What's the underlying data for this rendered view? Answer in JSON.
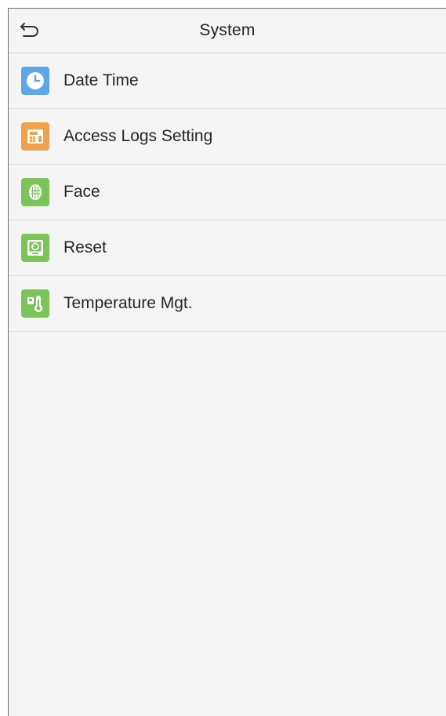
{
  "header": {
    "back_icon": "back-arrow-icon",
    "title": "System"
  },
  "menu": {
    "items": [
      {
        "label": "Date Time",
        "icon": "clock-icon",
        "color": "#5ea6ea"
      },
      {
        "label": "Access Logs Setting",
        "icon": "logs-setting-icon",
        "color": "#f1a14b"
      },
      {
        "label": "Face",
        "icon": "face-icon",
        "color": "#7cc35a"
      },
      {
        "label": "Reset",
        "icon": "reset-icon",
        "color": "#7cc35a"
      },
      {
        "label": "Temperature Mgt.",
        "icon": "thermometer-icon",
        "color": "#7cc35a"
      }
    ]
  }
}
